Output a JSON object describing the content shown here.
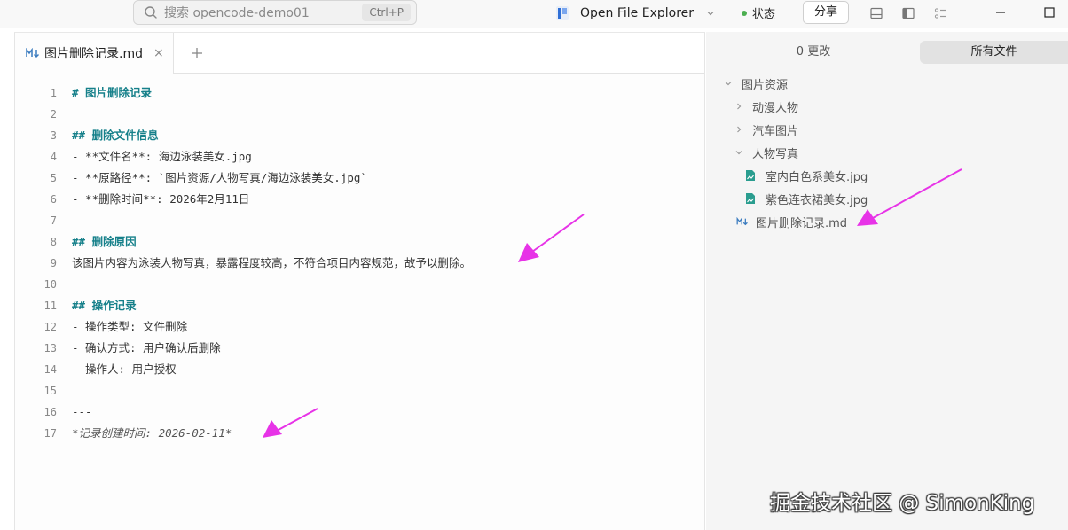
{
  "topbar": {
    "search_placeholder": "搜索 opencode-demo01",
    "search_shortcut": "Ctrl+P",
    "open_explorer_label": "Open File Explorer",
    "status_label": "状态",
    "share_label": "分享"
  },
  "editor": {
    "tab_label": "图片删除记录.md",
    "tab_close": "×",
    "lines": [
      {
        "n": "1",
        "text": "# 图片删除记录",
        "style": "h"
      },
      {
        "n": "2",
        "text": "",
        "style": ""
      },
      {
        "n": "3",
        "text": "## 删除文件信息",
        "style": "h"
      },
      {
        "n": "4",
        "text": "- **文件名**: 海边泳装美女.jpg",
        "style": ""
      },
      {
        "n": "5",
        "text": "- **原路径**: `图片资源/人物写真/海边泳装美女.jpg`",
        "style": ""
      },
      {
        "n": "6",
        "text": "- **删除时间**: 2026年2月11日",
        "style": ""
      },
      {
        "n": "7",
        "text": "",
        "style": ""
      },
      {
        "n": "8",
        "text": "## 删除原因",
        "style": "h"
      },
      {
        "n": "9",
        "text": "该图片内容为泳装人物写真，暴露程度较高，不符合项目内容规范，故予以删除。",
        "style": ""
      },
      {
        "n": "10",
        "text": "",
        "style": ""
      },
      {
        "n": "11",
        "text": "## 操作记录",
        "style": "h"
      },
      {
        "n": "12",
        "text": "- 操作类型: 文件删除",
        "style": ""
      },
      {
        "n": "13",
        "text": "- 确认方式: 用户确认后删除",
        "style": ""
      },
      {
        "n": "14",
        "text": "- 操作人: 用户授权",
        "style": ""
      },
      {
        "n": "15",
        "text": "",
        "style": ""
      },
      {
        "n": "16",
        "text": "---",
        "style": ""
      },
      {
        "n": "17",
        "text": "*记录创建时间: 2026-02-11*",
        "style": "em"
      }
    ]
  },
  "right_panel": {
    "changes_tab": "0 更改",
    "all_files_tab": "所有文件",
    "tree": {
      "root": "图片资源",
      "folder_anime": "动漫人物",
      "folder_cars": "汽车图片",
      "folder_portrait": "人物写真",
      "file_1": "室内白色系美女.jpg",
      "file_2": "紫色连衣裙美女.jpg",
      "file_md": "图片删除记录.md"
    }
  },
  "watermark": "掘金技术社区 @ SimonKing",
  "colors": {
    "heading": "#16808a",
    "arrow": "#e733e7",
    "image_file_icon": "#2a9d8f",
    "md_icon": "#3a7bbf"
  },
  "icons": [
    "search-icon",
    "app-icon",
    "chevron-down-icon",
    "layout-bottom-icon",
    "layout-sidebar-icon",
    "settings-list-icon",
    "minimize-icon",
    "maximize-icon",
    "markdown-icon",
    "close-icon",
    "plus-icon",
    "chevron-right-icon",
    "image-file-icon"
  ]
}
